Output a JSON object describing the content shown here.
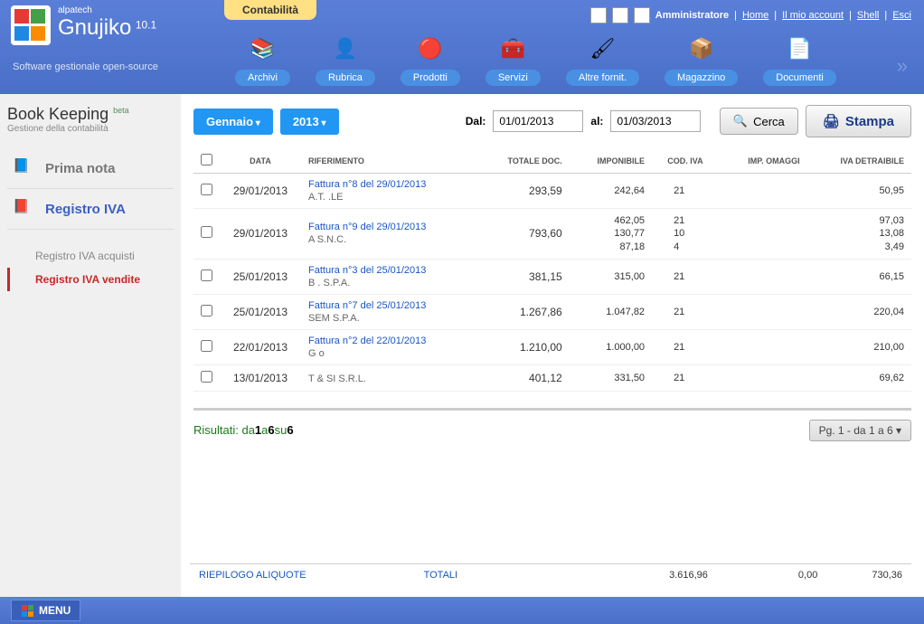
{
  "brand": {
    "company": "alpatech",
    "name": "Gnujiko",
    "version": "10.1",
    "tagline": "Software gestionale open-source"
  },
  "tab": "Contabilità",
  "user_label": "Amministratore",
  "top_links": [
    "Home",
    "Il mio account",
    "Shell",
    "Esci"
  ],
  "nav": [
    {
      "label": "Archivi"
    },
    {
      "label": "Rubrica"
    },
    {
      "label": "Prodotti"
    },
    {
      "label": "Servizi"
    },
    {
      "label": "Altre fornit."
    },
    {
      "label": "Magazzino"
    },
    {
      "label": "Documenti"
    }
  ],
  "module": {
    "title": "Book Keeping",
    "badge": "beta",
    "subtitle": "Gestione della contabilità"
  },
  "side": {
    "items": [
      {
        "label": "Prima nota",
        "active": false
      },
      {
        "label": "Registro IVA",
        "active": true
      }
    ],
    "subitems": [
      {
        "label": "Registro IVA acquisti",
        "active": false
      },
      {
        "label": "Registro IVA vendite",
        "active": true
      }
    ]
  },
  "filter": {
    "month": "Gennaio",
    "year": "2013",
    "from_label": "Dal:",
    "from_value": "01/01/2013",
    "to_label": "al:",
    "to_value": "01/03/2013",
    "search_label": "Cerca",
    "print_label": "Stampa"
  },
  "cols": [
    "DATA",
    "RIFERIMENTO",
    "TOTALE DOC.",
    "IMPONIBILE",
    "COD. IVA",
    "IMP. OMAGGI",
    "IVA DETRAIBILE"
  ],
  "rows": [
    {
      "date": "29/01/2013",
      "ref": "Fattura n°8 del 29/01/2013",
      "ref2": "A.T.                                    .LE",
      "tot": "293,59",
      "imp": "242,64",
      "cod": "21",
      "omag": "",
      "iva": "50,95"
    },
    {
      "date": "29/01/2013",
      "ref": "Fattura n°9 del 29/01/2013",
      "ref2": "A                          S.N.C.",
      "tot": "793,60",
      "imp": "462,05\n130,77\n87,18",
      "cod": "21\n10\n4",
      "omag": "",
      "iva": "97,03\n13,08\n3,49"
    },
    {
      "date": "25/01/2013",
      "ref": "Fattura n°3 del 25/01/2013",
      "ref2": "B                             . S.P.A.",
      "tot": "381,15",
      "imp": "315,00",
      "cod": "21",
      "omag": "",
      "iva": "66,15"
    },
    {
      "date": "25/01/2013",
      "ref": "Fattura n°7 del 25/01/2013",
      "ref2": "SEM                              S.P.A.",
      "tot": "1.267,86",
      "imp": "1.047,82",
      "cod": "21",
      "omag": "",
      "iva": "220,04"
    },
    {
      "date": "22/01/2013",
      "ref": "Fattura n°2 del 22/01/2013",
      "ref2": "G                o",
      "tot": "1.210,00",
      "imp": "1.000,00",
      "cod": "21",
      "omag": "",
      "iva": "210,00"
    },
    {
      "date": "13/01/2013",
      "ref": "",
      "ref2": "T & SI S.R.L.",
      "tot": "401,12",
      "imp": "331,50",
      "cod": "21",
      "omag": "",
      "iva": "69,62"
    }
  ],
  "results": {
    "prefix": "Risultati: da ",
    "a": "1",
    "mid": " a ",
    "b": "6",
    "su": " su ",
    "tot": "6"
  },
  "pager": "Pg. 1 - da 1 a 6  ▾",
  "summary": {
    "label": "RIEPILOGO ALIQUOTE",
    "totali": "TOTALI",
    "imp": "3.616,96",
    "omag": "0,00",
    "iva": "730,36"
  },
  "footer_menu": "MENU"
}
